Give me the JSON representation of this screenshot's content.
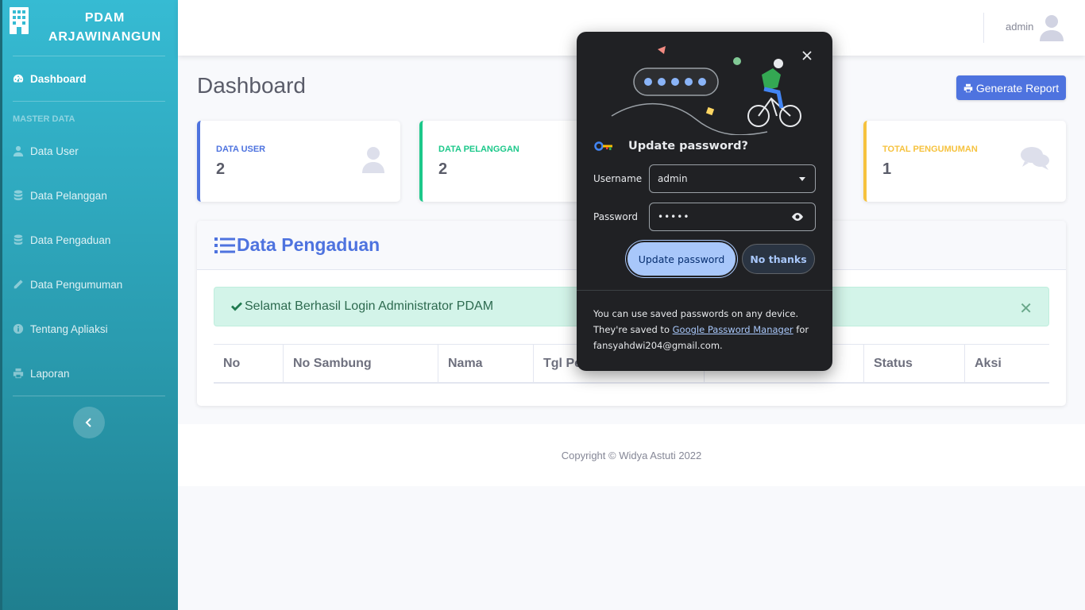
{
  "sidebar": {
    "brand_line1": "PDAM",
    "brand_line2": "ARJAWINANGUN",
    "dashboard": "Dashboard",
    "heading": "MASTER DATA",
    "items": [
      {
        "label": "Data User",
        "icon": "user-icon"
      },
      {
        "label": "Data Pelanggan",
        "icon": "database-icon"
      },
      {
        "label": "Data Pengaduan",
        "icon": "database-icon"
      },
      {
        "label": "Data Pengumuman",
        "icon": "pencil-icon"
      },
      {
        "label": "Tentang Apliaksi",
        "icon": "info-icon"
      },
      {
        "label": "Laporan",
        "icon": "print-icon"
      }
    ]
  },
  "topbar": {
    "user_name": "admin"
  },
  "page": {
    "title": "Dashboard",
    "report_button": "Generate Report"
  },
  "cards": [
    {
      "label": "DATA USER",
      "value": "2",
      "color": "#4e73df"
    },
    {
      "label": "DATA PELANGGAN",
      "value": "2",
      "color": "#1cc88a"
    },
    {
      "label": "TOTAL PENGUMUMAN",
      "value": "1",
      "color": "#f6c23e"
    }
  ],
  "panel": {
    "title": "Data Pengaduan",
    "alert": "Selamat Berhasil Login Administrator PDAM",
    "columns": [
      "No",
      "No Sambung",
      "Nama",
      "Tgl Pe",
      "",
      "Status",
      "Aksi"
    ]
  },
  "footer": {
    "text": "Copyright © Widya Astuti 2022"
  },
  "password_popup": {
    "title": "Update password?",
    "username_label": "Username",
    "username_value": "admin",
    "password_label": "Password",
    "password_value": "•••••",
    "update_button": "Update password",
    "no_button": "No thanks",
    "footer_pre": "You can use saved passwords on any device. They're saved to ",
    "footer_link": "Google Password Manager",
    "footer_post": " for fansyahdwi204@gmail.com."
  }
}
